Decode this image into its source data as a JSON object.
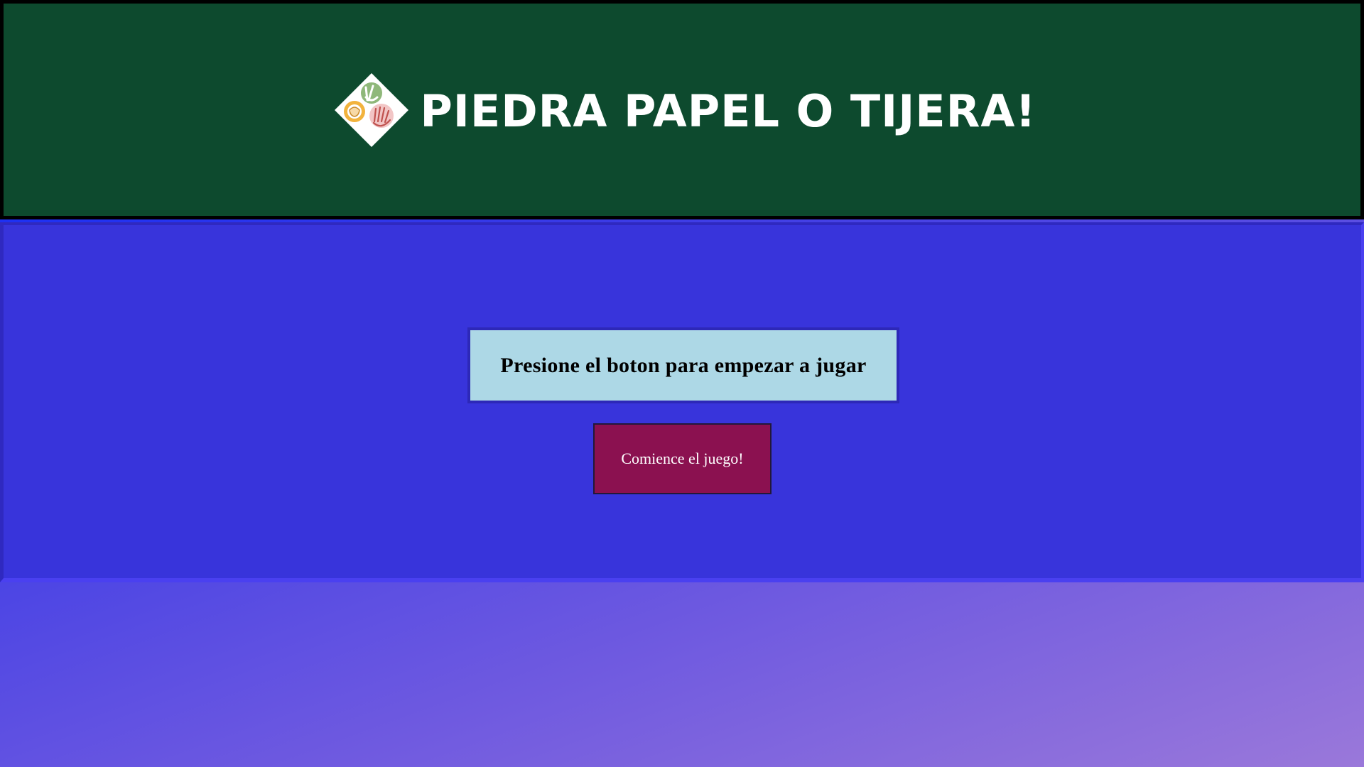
{
  "header": {
    "title": "PIEDRA PAPEL O TIJERA!",
    "logo_icon": "rock-paper-scissors-logo-icon",
    "background_color": "#0d4a2e"
  },
  "main": {
    "message": "Presione el boton para empezar a jugar",
    "start_button_label": "Comience el juego!",
    "panel_color": "#3834db",
    "message_box_color": "#add8e6",
    "button_color": "#8b1150"
  }
}
